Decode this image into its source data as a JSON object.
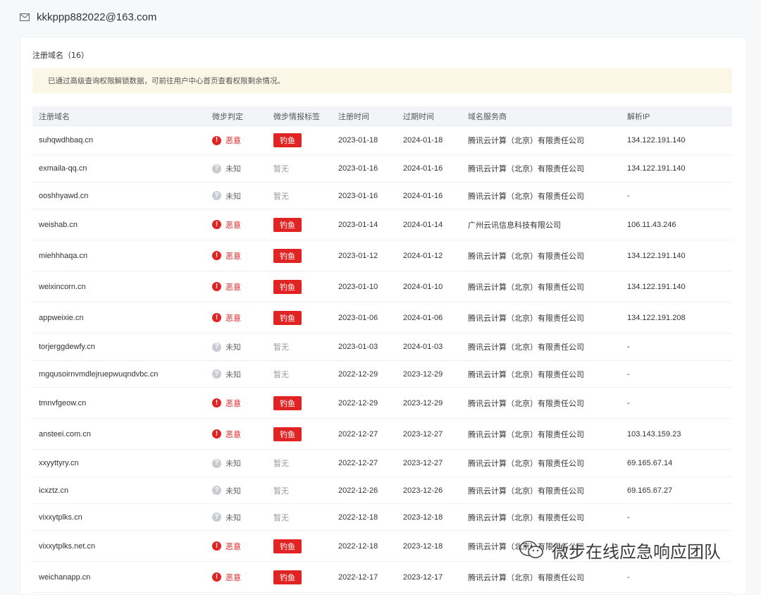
{
  "email": "kkkppp882022@163.com",
  "section": {
    "title": "注册域名（16）"
  },
  "notice": "已通过高级查询权限解锁数据，可前往用户中心首页查看权限剩余情况。",
  "columns": [
    "注册域名",
    "微步判定",
    "微步情报标签",
    "注册时间",
    "过期时间",
    "域名服务商",
    "解析IP"
  ],
  "rows": [
    {
      "domain": "suhqwdhbaq.cn",
      "judge": "恶意",
      "judge_type": "bad",
      "tag": "钓鱼",
      "reg": "2023-01-18",
      "exp": "2024-01-18",
      "isp": "腾讯云计算（北京）有限责任公司",
      "ip": "134.122.191.140"
    },
    {
      "domain": "exmaila-qq.cn",
      "judge": "未知",
      "judge_type": "unk",
      "tag": "暂无",
      "reg": "2023-01-16",
      "exp": "2024-01-16",
      "isp": "腾讯云计算（北京）有限责任公司",
      "ip": "134.122.191.140"
    },
    {
      "domain": "ooshhyawd.cn",
      "judge": "未知",
      "judge_type": "unk",
      "tag": "暂无",
      "reg": "2023-01-16",
      "exp": "2024-01-16",
      "isp": "腾讯云计算（北京）有限责任公司",
      "ip": "-"
    },
    {
      "domain": "weishab.cn",
      "judge": "恶意",
      "judge_type": "bad",
      "tag": "钓鱼",
      "reg": "2023-01-14",
      "exp": "2024-01-14",
      "isp": "广州云讯信息科技有限公司",
      "ip": "106.11.43.246"
    },
    {
      "domain": "miehhhaqa.cn",
      "judge": "恶意",
      "judge_type": "bad",
      "tag": "钓鱼",
      "reg": "2023-01-12",
      "exp": "2024-01-12",
      "isp": "腾讯云计算（北京）有限责任公司",
      "ip": "134.122.191.140"
    },
    {
      "domain": "weixincorn.cn",
      "judge": "恶意",
      "judge_type": "bad",
      "tag": "钓鱼",
      "reg": "2023-01-10",
      "exp": "2024-01-10",
      "isp": "腾讯云计算（北京）有限责任公司",
      "ip": "134.122.191.140"
    },
    {
      "domain": "appweixie.cn",
      "judge": "恶意",
      "judge_type": "bad",
      "tag": "钓鱼",
      "reg": "2023-01-06",
      "exp": "2024-01-06",
      "isp": "腾讯云计算（北京）有限责任公司",
      "ip": "134.122.191.208"
    },
    {
      "domain": "torjerggdewfy.cn",
      "judge": "未知",
      "judge_type": "unk",
      "tag": "暂无",
      "reg": "2023-01-03",
      "exp": "2024-01-03",
      "isp": "腾讯云计算（北京）有限责任公司",
      "ip": "-"
    },
    {
      "domain": "mgqusoirnvmdlejruepwuqndvbc.cn",
      "judge": "未知",
      "judge_type": "unk",
      "tag": "暂无",
      "reg": "2022-12-29",
      "exp": "2023-12-29",
      "isp": "腾讯云计算（北京）有限责任公司",
      "ip": "-"
    },
    {
      "domain": "tmnvfgeow.cn",
      "judge": "恶意",
      "judge_type": "bad",
      "tag": "钓鱼",
      "reg": "2022-12-29",
      "exp": "2023-12-29",
      "isp": "腾讯云计算（北京）有限责任公司",
      "ip": "-"
    },
    {
      "domain": "ansteei.com.cn",
      "judge": "恶意",
      "judge_type": "bad",
      "tag": "钓鱼",
      "reg": "2022-12-27",
      "exp": "2023-12-27",
      "isp": "腾讯云计算（北京）有限责任公司",
      "ip": "103.143.159.23"
    },
    {
      "domain": "xxyyttyry.cn",
      "judge": "未知",
      "judge_type": "unk",
      "tag": "暂无",
      "reg": "2022-12-27",
      "exp": "2023-12-27",
      "isp": "腾讯云计算（北京）有限责任公司",
      "ip": "69.165.67.14"
    },
    {
      "domain": "icxztz.cn",
      "judge": "未知",
      "judge_type": "unk",
      "tag": "暂无",
      "reg": "2022-12-26",
      "exp": "2023-12-26",
      "isp": "腾讯云计算（北京）有限责任公司",
      "ip": "69.165.67.27"
    },
    {
      "domain": "vixxytplks.cn",
      "judge": "未知",
      "judge_type": "unk",
      "tag": "暂无",
      "reg": "2022-12-18",
      "exp": "2023-12-18",
      "isp": "腾讯云计算（北京）有限责任公司",
      "ip": "-"
    },
    {
      "domain": "vixxytplks.net.cn",
      "judge": "恶意",
      "judge_type": "bad",
      "tag": "钓鱼",
      "reg": "2022-12-18",
      "exp": "2023-12-18",
      "isp": "腾讯云计算（北京）有限责任公司",
      "ip": "-"
    },
    {
      "domain": "weichanapp.cn",
      "judge": "恶意",
      "judge_type": "bad",
      "tag": "钓鱼",
      "reg": "2022-12-17",
      "exp": "2023-12-17",
      "isp": "腾讯云计算（北京）有限责任公司",
      "ip": "-"
    }
  ],
  "watermark": "微步在线应急响应团队",
  "colors": {
    "malicious": "#e02424",
    "unknown": "#c8cbd0",
    "notice_bg": "#fcf6e6",
    "header_bg": "#f2f4f7"
  }
}
